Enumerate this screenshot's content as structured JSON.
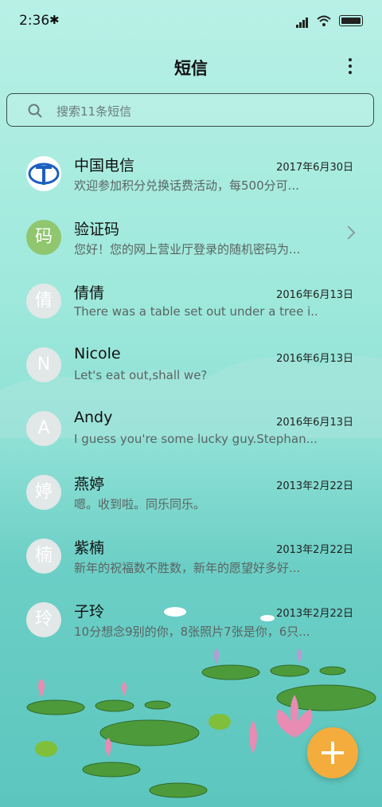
{
  "status_bar": {
    "time": "2:36"
  },
  "header": {
    "title": "短信"
  },
  "search": {
    "placeholder": "搜索11条短信"
  },
  "conversations": [
    {
      "name": "中国电信",
      "date": "2017年6月30日",
      "preview": "欢迎参加积分兑换话费活动，每500分可...",
      "avatar": "",
      "avatar_type": "china-telecom-logo"
    },
    {
      "name": "验证码",
      "date": "",
      "preview": "您好！您的网上营业厅登录的随机密码为...",
      "avatar": "码",
      "avatar_color": "#8fc66e"
    },
    {
      "name": "倩倩",
      "date": "2016年6月13日",
      "preview": "There was a table set out under a tree i...",
      "avatar": "倩"
    },
    {
      "name": "Nicole",
      "date": "2016年6月13日",
      "preview": "Let's eat out,shall we?",
      "avatar": "N"
    },
    {
      "name": "Andy",
      "date": "2016年6月13日",
      "preview": "I guess you're some lucky guy.Stephan...",
      "avatar": "A"
    },
    {
      "name": "燕婷",
      "date": "2013年2月22日",
      "preview": "嗯。收到啦。同乐同乐。",
      "avatar": "婷"
    },
    {
      "name": "紫楠",
      "date": "2013年2月22日",
      "preview": "新年的祝福数不胜数，新年的愿望好多好...",
      "avatar": "楠"
    },
    {
      "name": "子玲",
      "date": "2013年2月22日",
      "preview": "10分想念9别的你，8张照片7张是你，6只...",
      "avatar": "玲"
    }
  ],
  "colors": {
    "fab": "#f4ac3c",
    "accent_green": "#8fc66e"
  }
}
